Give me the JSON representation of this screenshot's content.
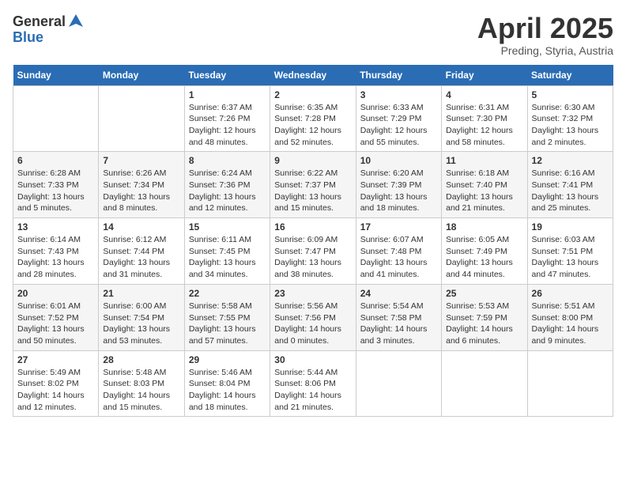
{
  "header": {
    "logo_general": "General",
    "logo_blue": "Blue",
    "title": "April 2025",
    "subtitle": "Preding, Styria, Austria"
  },
  "weekdays": [
    "Sunday",
    "Monday",
    "Tuesday",
    "Wednesday",
    "Thursday",
    "Friday",
    "Saturday"
  ],
  "weeks": [
    [
      {
        "day": "",
        "info": ""
      },
      {
        "day": "",
        "info": ""
      },
      {
        "day": "1",
        "info": "Sunrise: 6:37 AM\nSunset: 7:26 PM\nDaylight: 12 hours\nand 48 minutes."
      },
      {
        "day": "2",
        "info": "Sunrise: 6:35 AM\nSunset: 7:28 PM\nDaylight: 12 hours\nand 52 minutes."
      },
      {
        "day": "3",
        "info": "Sunrise: 6:33 AM\nSunset: 7:29 PM\nDaylight: 12 hours\nand 55 minutes."
      },
      {
        "day": "4",
        "info": "Sunrise: 6:31 AM\nSunset: 7:30 PM\nDaylight: 12 hours\nand 58 minutes."
      },
      {
        "day": "5",
        "info": "Sunrise: 6:30 AM\nSunset: 7:32 PM\nDaylight: 13 hours\nand 2 minutes."
      }
    ],
    [
      {
        "day": "6",
        "info": "Sunrise: 6:28 AM\nSunset: 7:33 PM\nDaylight: 13 hours\nand 5 minutes."
      },
      {
        "day": "7",
        "info": "Sunrise: 6:26 AM\nSunset: 7:34 PM\nDaylight: 13 hours\nand 8 minutes."
      },
      {
        "day": "8",
        "info": "Sunrise: 6:24 AM\nSunset: 7:36 PM\nDaylight: 13 hours\nand 12 minutes."
      },
      {
        "day": "9",
        "info": "Sunrise: 6:22 AM\nSunset: 7:37 PM\nDaylight: 13 hours\nand 15 minutes."
      },
      {
        "day": "10",
        "info": "Sunrise: 6:20 AM\nSunset: 7:39 PM\nDaylight: 13 hours\nand 18 minutes."
      },
      {
        "day": "11",
        "info": "Sunrise: 6:18 AM\nSunset: 7:40 PM\nDaylight: 13 hours\nand 21 minutes."
      },
      {
        "day": "12",
        "info": "Sunrise: 6:16 AM\nSunset: 7:41 PM\nDaylight: 13 hours\nand 25 minutes."
      }
    ],
    [
      {
        "day": "13",
        "info": "Sunrise: 6:14 AM\nSunset: 7:43 PM\nDaylight: 13 hours\nand 28 minutes."
      },
      {
        "day": "14",
        "info": "Sunrise: 6:12 AM\nSunset: 7:44 PM\nDaylight: 13 hours\nand 31 minutes."
      },
      {
        "day": "15",
        "info": "Sunrise: 6:11 AM\nSunset: 7:45 PM\nDaylight: 13 hours\nand 34 minutes."
      },
      {
        "day": "16",
        "info": "Sunrise: 6:09 AM\nSunset: 7:47 PM\nDaylight: 13 hours\nand 38 minutes."
      },
      {
        "day": "17",
        "info": "Sunrise: 6:07 AM\nSunset: 7:48 PM\nDaylight: 13 hours\nand 41 minutes."
      },
      {
        "day": "18",
        "info": "Sunrise: 6:05 AM\nSunset: 7:49 PM\nDaylight: 13 hours\nand 44 minutes."
      },
      {
        "day": "19",
        "info": "Sunrise: 6:03 AM\nSunset: 7:51 PM\nDaylight: 13 hours\nand 47 minutes."
      }
    ],
    [
      {
        "day": "20",
        "info": "Sunrise: 6:01 AM\nSunset: 7:52 PM\nDaylight: 13 hours\nand 50 minutes."
      },
      {
        "day": "21",
        "info": "Sunrise: 6:00 AM\nSunset: 7:54 PM\nDaylight: 13 hours\nand 53 minutes."
      },
      {
        "day": "22",
        "info": "Sunrise: 5:58 AM\nSunset: 7:55 PM\nDaylight: 13 hours\nand 57 minutes."
      },
      {
        "day": "23",
        "info": "Sunrise: 5:56 AM\nSunset: 7:56 PM\nDaylight: 14 hours\nand 0 minutes."
      },
      {
        "day": "24",
        "info": "Sunrise: 5:54 AM\nSunset: 7:58 PM\nDaylight: 14 hours\nand 3 minutes."
      },
      {
        "day": "25",
        "info": "Sunrise: 5:53 AM\nSunset: 7:59 PM\nDaylight: 14 hours\nand 6 minutes."
      },
      {
        "day": "26",
        "info": "Sunrise: 5:51 AM\nSunset: 8:00 PM\nDaylight: 14 hours\nand 9 minutes."
      }
    ],
    [
      {
        "day": "27",
        "info": "Sunrise: 5:49 AM\nSunset: 8:02 PM\nDaylight: 14 hours\nand 12 minutes."
      },
      {
        "day": "28",
        "info": "Sunrise: 5:48 AM\nSunset: 8:03 PM\nDaylight: 14 hours\nand 15 minutes."
      },
      {
        "day": "29",
        "info": "Sunrise: 5:46 AM\nSunset: 8:04 PM\nDaylight: 14 hours\nand 18 minutes."
      },
      {
        "day": "30",
        "info": "Sunrise: 5:44 AM\nSunset: 8:06 PM\nDaylight: 14 hours\nand 21 minutes."
      },
      {
        "day": "",
        "info": ""
      },
      {
        "day": "",
        "info": ""
      },
      {
        "day": "",
        "info": ""
      }
    ]
  ]
}
